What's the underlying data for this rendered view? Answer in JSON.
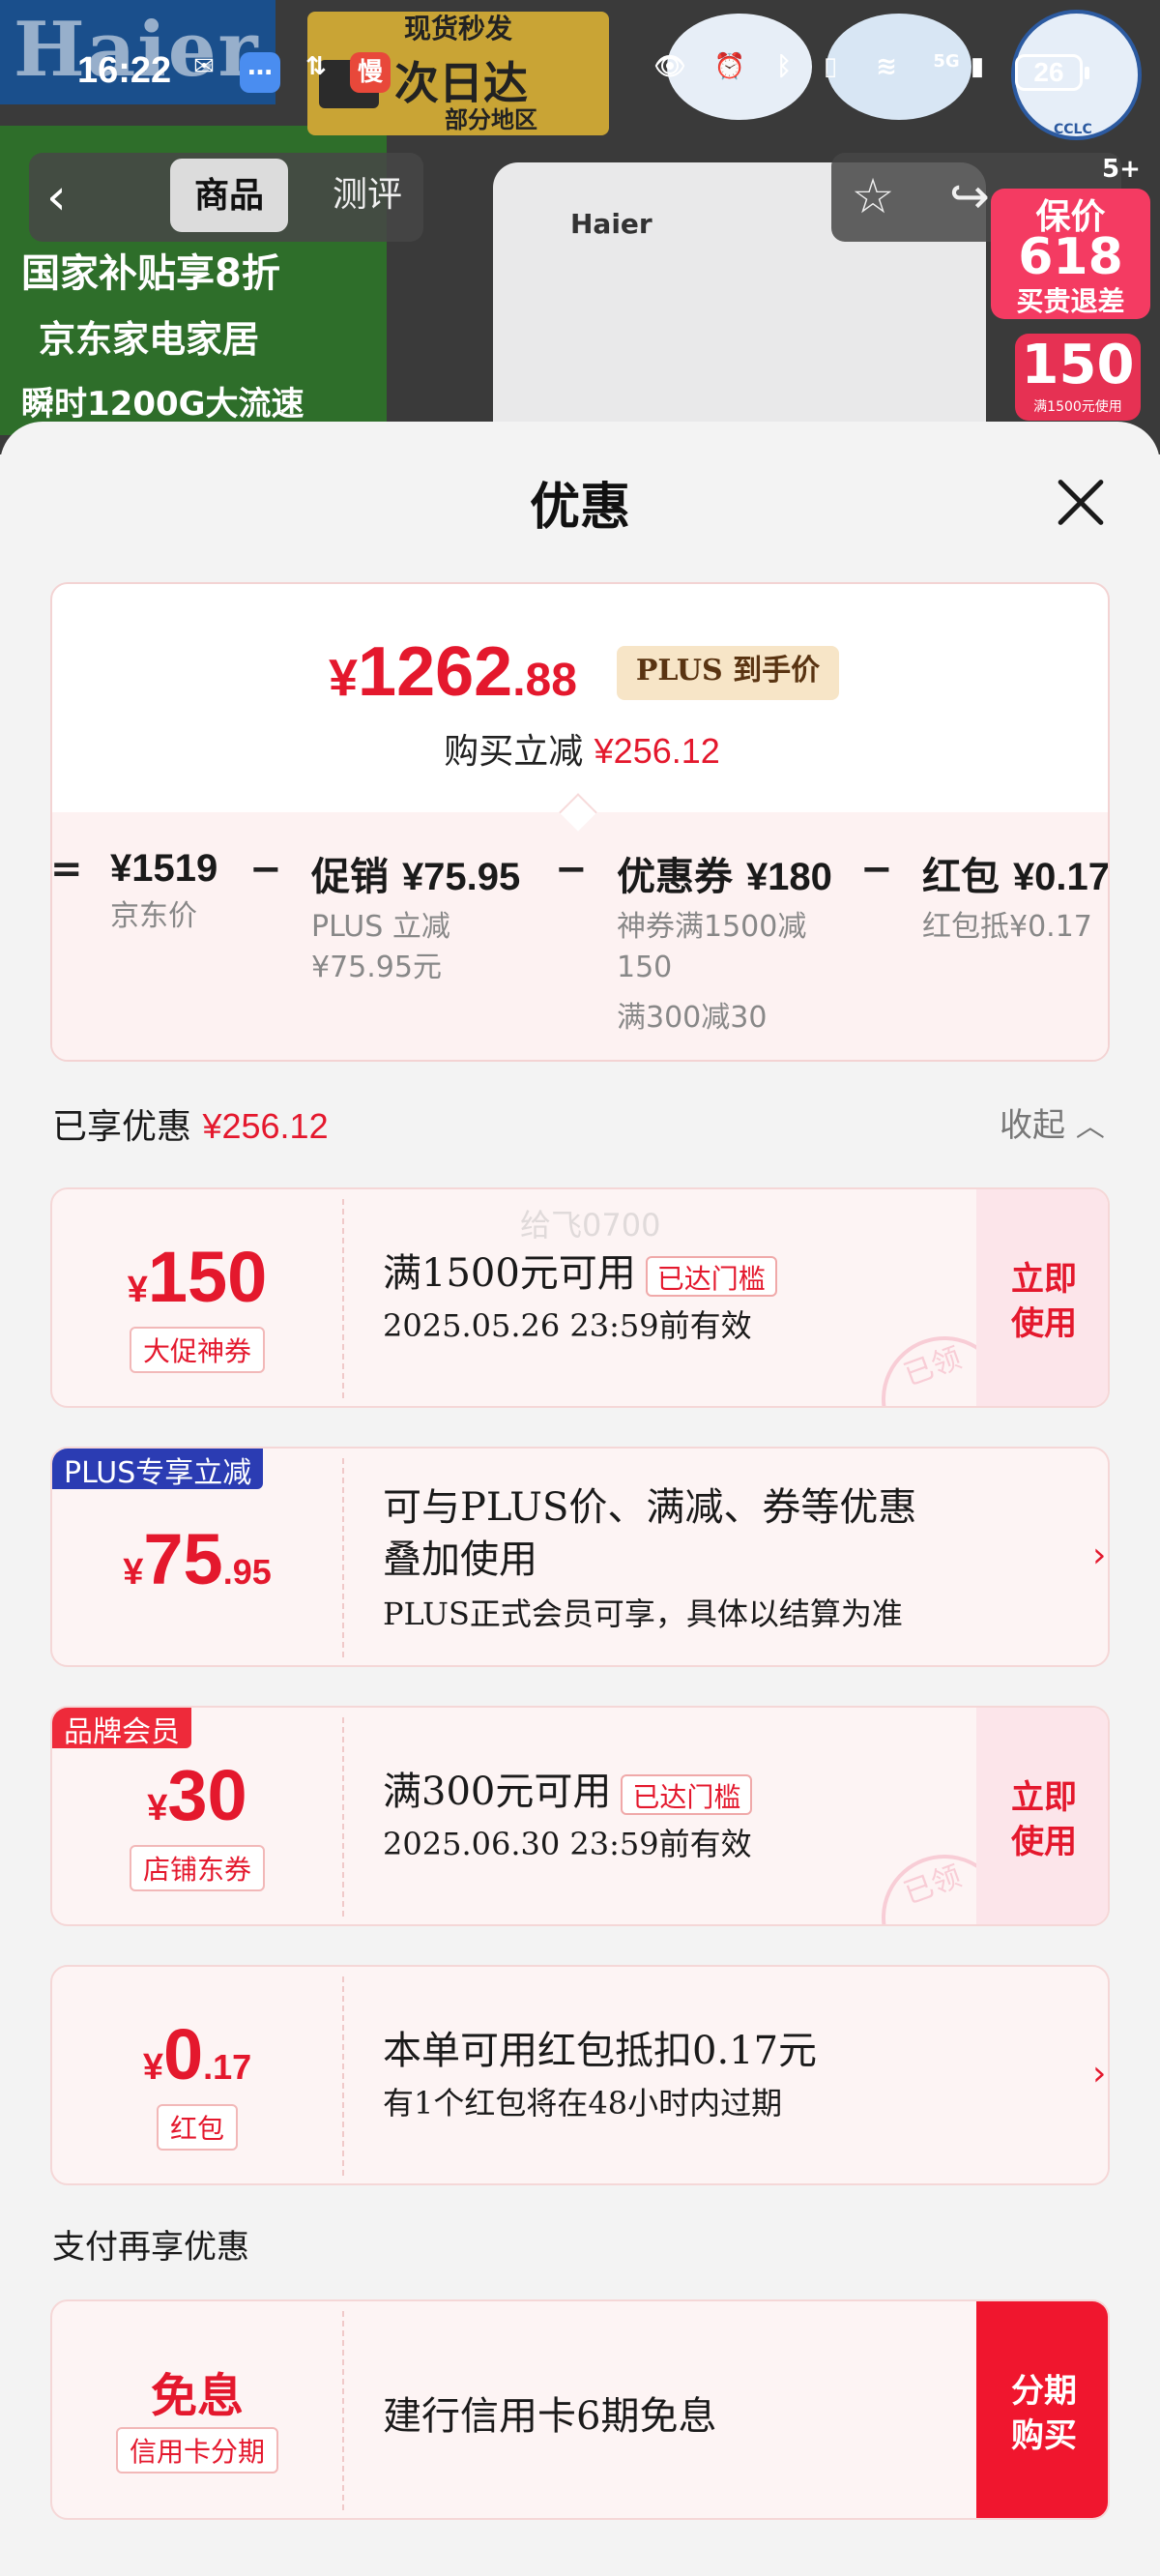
{
  "status_bar": {
    "time": "16:22",
    "network": "5G",
    "battery": "26",
    "icons": [
      "wechat-icon",
      "message-icon",
      "data-icon",
      "manman-icon",
      "eye-icon",
      "alarm-icon",
      "bluetooth-icon",
      "vibrate-icon",
      "wifi-icon",
      "signal-icon"
    ]
  },
  "background": {
    "flag_text": "Haier",
    "ship_top": "现货秒发",
    "ship_main": "次日达",
    "ship_sub": "部分地区",
    "badge3_text": "CCLC",
    "tabs": [
      "商品",
      "测评"
    ],
    "product_logo": "Haier",
    "banner_lines": [
      "国家补贴享8折",
      "京东家电家居",
      "瞬时1200G大流速"
    ],
    "promo_plus": "5+",
    "promo_main1": "保价",
    "promo_main2": "618",
    "promo_main3": "买贵退差",
    "promo_coupon": "150",
    "promo_coupon_sub": "满1500元使用"
  },
  "sheet": {
    "title": "优惠",
    "summary": {
      "price_symbol": "¥",
      "price_int": "1262",
      "price_dec": ".88",
      "price_tag": "PLUS 到手价",
      "reduce_label": "购买立减",
      "reduce_value": "¥256.12",
      "calc": [
        {
          "op": "=",
          "label": "",
          "value": "¥1519",
          "sub": [
            "京东价"
          ]
        },
        {
          "op": "−",
          "label": "促销",
          "value": "¥75.95",
          "sub": [
            "PLUS 立减",
            "¥75.95元"
          ]
        },
        {
          "op": "−",
          "label": "优惠券",
          "value": "¥180",
          "sub": [
            "神券满1500减",
            "150",
            "满300减30"
          ]
        },
        {
          "op": "−",
          "label": "红包",
          "value": "¥0.17",
          "sub": [
            "红包抵¥0.17"
          ]
        }
      ]
    },
    "enjoyed_label": "已享优惠",
    "enjoyed_value": "¥256.12",
    "collapse_label": "收起",
    "watermark": "给飞0700",
    "coupons": [
      {
        "symbol": "¥",
        "amount": "150",
        "decimal": "",
        "type": "大促神券",
        "title": "满1500元可用",
        "tag": "已达门槛",
        "expire": "2025.05.26 23:59前有效",
        "action_1": "立即",
        "action_2": "使用",
        "stamp": "已领"
      },
      {
        "corner": "PLUS专享立减",
        "symbol": "¥",
        "amount": "75",
        "decimal": ".95",
        "desc_1": "可与PLUS价、满减、券等优惠",
        "desc_2": "叠加使用",
        "desc_3": "PLUS正式会员可享，具体以结算为准"
      },
      {
        "corner": "品牌会员",
        "symbol": "¥",
        "amount": "30",
        "decimal": "",
        "type": "店铺东券",
        "title": "满300元可用",
        "tag": "已达门槛",
        "expire": "2025.06.30 23:59前有效",
        "action_1": "立即",
        "action_2": "使用",
        "stamp": "已领"
      },
      {
        "symbol": "¥",
        "amount": "0",
        "decimal": ".17",
        "type": "红包",
        "title": "本单可用红包抵扣0.17元",
        "sub": "有1个红包将在48小时内过期"
      }
    ],
    "pay_section_title": "支付再享优惠",
    "pay_offer": {
      "amount": "免息",
      "type": "信用卡分期",
      "title": "建行信用卡6期免息",
      "action_1": "分期",
      "action_2": "购买"
    }
  },
  "colors": {
    "accent_red": "#e4182d",
    "plus_blue": "#2b3cb3",
    "plus_gold_bg": "#f7e5c7"
  }
}
